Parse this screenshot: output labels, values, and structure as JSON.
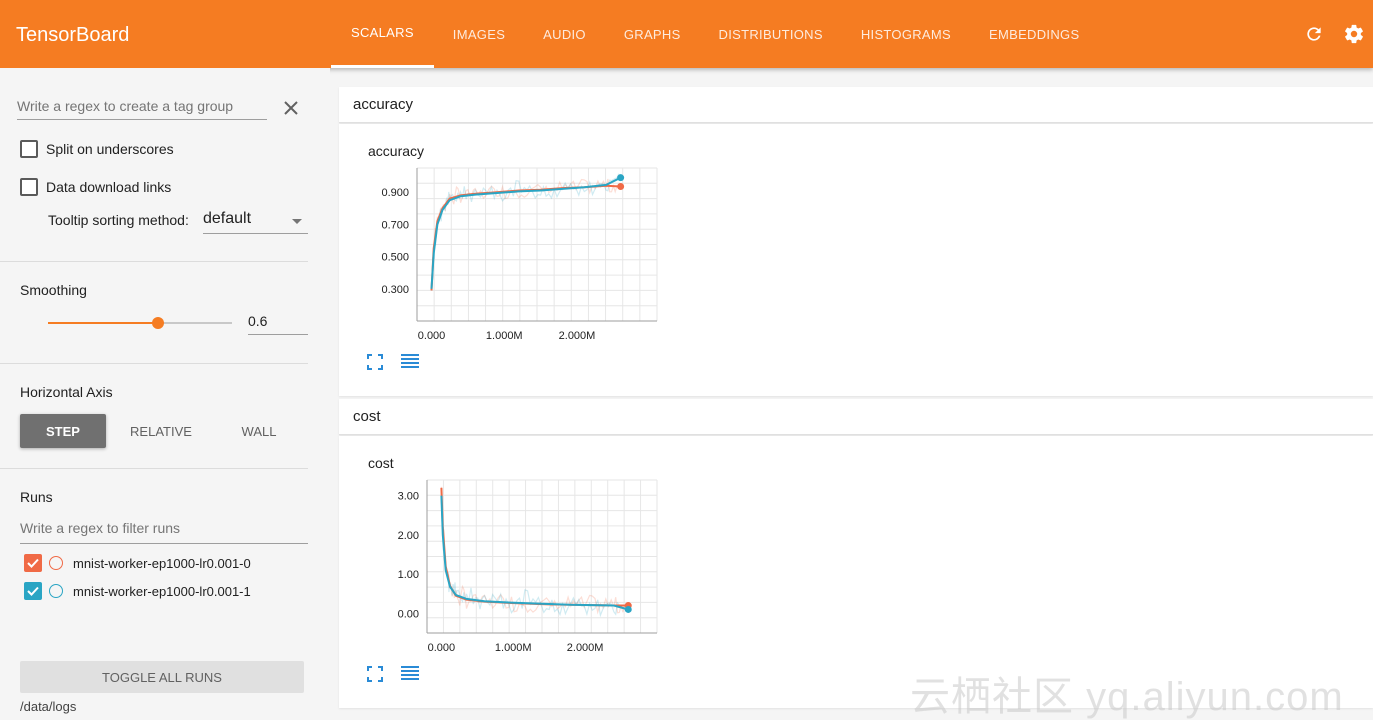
{
  "app": {
    "title": "TensorBoard"
  },
  "tabs": [
    {
      "label": "SCALARS",
      "active": true
    },
    {
      "label": "IMAGES"
    },
    {
      "label": "AUDIO"
    },
    {
      "label": "GRAPHS"
    },
    {
      "label": "DISTRIBUTIONS"
    },
    {
      "label": "HISTOGRAMS"
    },
    {
      "label": "EMBEDDINGS"
    }
  ],
  "top_icons": [
    "refresh-icon",
    "settings-icon"
  ],
  "sidebar": {
    "tag_group_placeholder": "Write a regex to create a tag group",
    "split_label": "Split on underscores",
    "download_label": "Data download links",
    "tooltip_label": "Tooltip sorting method:",
    "tooltip_value": "default",
    "smoothing_title": "Smoothing",
    "smoothing_value": "0.6",
    "smoothing_fraction": 0.6,
    "axis_title": "Horizontal Axis",
    "axis_options": [
      "STEP",
      "RELATIVE",
      "WALL"
    ],
    "axis_selected": "STEP",
    "runs_title": "Runs",
    "runs_placeholder": "Write a regex to filter runs",
    "runs": [
      {
        "name": "mnist-worker-ep1000-lr0.001-0",
        "color": "#f06a46",
        "checked": true
      },
      {
        "name": "mnist-worker-ep1000-lr0.001-1",
        "color": "#2aa5c4",
        "checked": true
      }
    ],
    "toggle_label": "TOGGLE ALL RUNS",
    "logdir": "/data/logs"
  },
  "groups": [
    {
      "header": "accuracy",
      "chart_title": "accuracy"
    },
    {
      "header": "cost",
      "chart_title": "cost"
    }
  ],
  "colors": {
    "accent": "#f57c22",
    "run0": "#f06a46",
    "run1": "#2aa5c4"
  },
  "watermark": "云栖社区 yq.aliyun.com",
  "chart_data": [
    {
      "type": "line",
      "title": "accuracy",
      "xlabel": "",
      "ylabel": "",
      "x_ticks": [
        "0.000",
        "1.000M",
        "2.000M"
      ],
      "y_ticks": [
        "0.300",
        "0.500",
        "0.700",
        "0.900"
      ],
      "xlim": [
        -200000,
        3100000
      ],
      "ylim": [
        0.1,
        1.05
      ],
      "grid": true,
      "series": [
        {
          "name": "mnist-worker-ep1000-lr0.001-0",
          "x": [
            0,
            30000,
            80000,
            150000,
            250000,
            400000,
            600000,
            900000,
            1200000,
            1500000,
            1800000,
            2100000,
            2400000,
            2600000
          ],
          "y": [
            0.29,
            0.55,
            0.72,
            0.8,
            0.86,
            0.88,
            0.89,
            0.9,
            0.91,
            0.915,
            0.925,
            0.93,
            0.94,
            0.935
          ]
        },
        {
          "name": "mnist-worker-ep1000-lr0.001-1",
          "x": [
            0,
            30000,
            80000,
            150000,
            250000,
            400000,
            600000,
            900000,
            1200000,
            1500000,
            1800000,
            2100000,
            2400000,
            2600000
          ],
          "y": [
            0.3,
            0.52,
            0.7,
            0.79,
            0.85,
            0.875,
            0.885,
            0.895,
            0.905,
            0.91,
            0.92,
            0.93,
            0.945,
            0.99
          ]
        }
      ]
    },
    {
      "type": "line",
      "title": "cost",
      "xlabel": "",
      "ylabel": "",
      "x_ticks": [
        "0.000",
        "1.000M",
        "2.000M"
      ],
      "y_ticks": [
        "0.00",
        "1.00",
        "2.00",
        "3.00"
      ],
      "xlim": [
        -200000,
        3000000
      ],
      "ylim": [
        -0.5,
        3.4
      ],
      "grid": true,
      "series": [
        {
          "name": "mnist-worker-ep1000-lr0.001-0",
          "x": [
            0,
            20000,
            60000,
            120000,
            200000,
            350000,
            600000,
            900000,
            1200000,
            1500000,
            1800000,
            2100000,
            2400000,
            2600000
          ],
          "y": [
            3.2,
            2.2,
            1.2,
            0.7,
            0.45,
            0.35,
            0.3,
            0.27,
            0.25,
            0.23,
            0.22,
            0.21,
            0.2,
            0.2
          ]
        },
        {
          "name": "mnist-worker-ep1000-lr0.001-1",
          "x": [
            0,
            20000,
            60000,
            120000,
            200000,
            350000,
            600000,
            900000,
            1200000,
            1500000,
            1800000,
            2100000,
            2400000,
            2600000
          ],
          "y": [
            3.0,
            2.0,
            1.1,
            0.68,
            0.47,
            0.37,
            0.31,
            0.28,
            0.26,
            0.24,
            0.22,
            0.21,
            0.2,
            0.1
          ]
        }
      ]
    }
  ]
}
